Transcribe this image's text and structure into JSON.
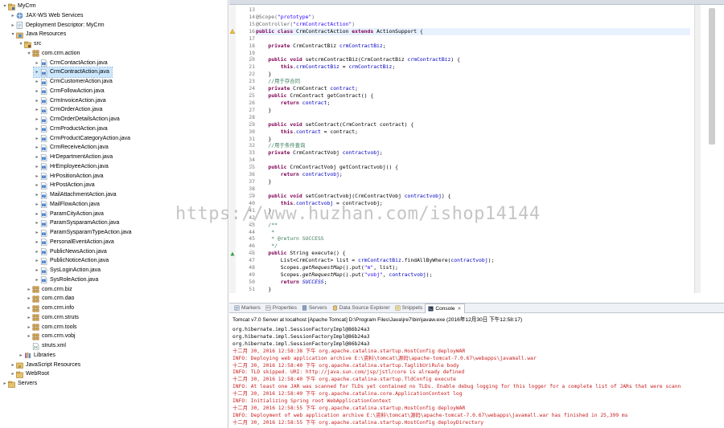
{
  "explorer": {
    "items": [
      {
        "label": "MyCrm",
        "depth": 0,
        "tw": "▾",
        "icon": "project"
      },
      {
        "label": "JAX-WS Web Services",
        "depth": 1,
        "tw": "▸",
        "icon": "webservice"
      },
      {
        "label": "Deployment Descriptor: MyCrm",
        "depth": 1,
        "tw": "▸",
        "icon": "descriptor"
      },
      {
        "label": "Java Resources",
        "depth": 1,
        "tw": "▾",
        "icon": "javares"
      },
      {
        "label": "src",
        "depth": 2,
        "tw": "▾",
        "icon": "srcfolder"
      },
      {
        "label": "com.crm.action",
        "depth": 3,
        "tw": "▾",
        "icon": "package"
      },
      {
        "label": "CrmContactAction.java",
        "depth": 4,
        "tw": "▸",
        "icon": "java"
      },
      {
        "label": "CrmContractAction.java",
        "depth": 4,
        "tw": "▸",
        "icon": "java",
        "selected": true
      },
      {
        "label": "CrmCustomerAction.java",
        "depth": 4,
        "tw": "▸",
        "icon": "java"
      },
      {
        "label": "CrmFollowAction.java",
        "depth": 4,
        "tw": "▸",
        "icon": "java"
      },
      {
        "label": "CrmInvoiceAction.java",
        "depth": 4,
        "tw": "▸",
        "icon": "java"
      },
      {
        "label": "CrmOrderAction.java",
        "depth": 4,
        "tw": "▸",
        "icon": "java"
      },
      {
        "label": "CrmOrderDetailsAction.java",
        "depth": 4,
        "tw": "▸",
        "icon": "java"
      },
      {
        "label": "CrmProductAction.java",
        "depth": 4,
        "tw": "▸",
        "icon": "java"
      },
      {
        "label": "CrmProductCategoryAction.java",
        "depth": 4,
        "tw": "▸",
        "icon": "java"
      },
      {
        "label": "CrmReceiveAction.java",
        "depth": 4,
        "tw": "▸",
        "icon": "java"
      },
      {
        "label": "HrDepartmentAction.java",
        "depth": 4,
        "tw": "▸",
        "icon": "java"
      },
      {
        "label": "HrEmployeeAction.java",
        "depth": 4,
        "tw": "▸",
        "icon": "java"
      },
      {
        "label": "HrPositionAction.java",
        "depth": 4,
        "tw": "▸",
        "icon": "java"
      },
      {
        "label": "HrPostAction.java",
        "depth": 4,
        "tw": "▸",
        "icon": "java"
      },
      {
        "label": "MailAttachmentAction.java",
        "depth": 4,
        "tw": "▸",
        "icon": "java"
      },
      {
        "label": "MailFlowAction.java",
        "depth": 4,
        "tw": "▸",
        "icon": "java"
      },
      {
        "label": "ParamCityAction.java",
        "depth": 4,
        "tw": "▸",
        "icon": "java"
      },
      {
        "label": "ParamSysparamAction.java",
        "depth": 4,
        "tw": "▸",
        "icon": "java"
      },
      {
        "label": "ParamSysparamTypeAction.java",
        "depth": 4,
        "tw": "▸",
        "icon": "java"
      },
      {
        "label": "PersonalEventAction.java",
        "depth": 4,
        "tw": "▸",
        "icon": "java"
      },
      {
        "label": "PublicNewsAction.java",
        "depth": 4,
        "tw": "▸",
        "icon": "java"
      },
      {
        "label": "PublicNoticeAction.java",
        "depth": 4,
        "tw": "▸",
        "icon": "java"
      },
      {
        "label": "SysLoginAction.java",
        "depth": 4,
        "tw": "▸",
        "icon": "java"
      },
      {
        "label": "SysRoleAction.java",
        "depth": 4,
        "tw": "▸",
        "icon": "java"
      },
      {
        "label": "com.crm.biz",
        "depth": 3,
        "tw": "▸",
        "icon": "package"
      },
      {
        "label": "com.crm.dao",
        "depth": 3,
        "tw": "▸",
        "icon": "package"
      },
      {
        "label": "com.crm.info",
        "depth": 3,
        "tw": "▸",
        "icon": "package"
      },
      {
        "label": "com.crm.struts",
        "depth": 3,
        "tw": "▸",
        "icon": "package"
      },
      {
        "label": "com.crm.tools",
        "depth": 3,
        "tw": "▸",
        "icon": "package"
      },
      {
        "label": "com.crm.vobj",
        "depth": 3,
        "tw": "▸",
        "icon": "package"
      },
      {
        "label": "struts.xml",
        "depth": 3,
        "tw": "",
        "icon": "xml"
      },
      {
        "label": "Libraries",
        "depth": 2,
        "tw": "▸",
        "icon": "library"
      },
      {
        "label": "JavaScript Resources",
        "depth": 1,
        "tw": "▸",
        "icon": "jsres"
      },
      {
        "label": "WebRoot",
        "depth": 1,
        "tw": "▸",
        "icon": "folder"
      },
      {
        "label": "Servers",
        "depth": 0,
        "tw": "▸",
        "icon": "folder"
      }
    ]
  },
  "editor": {
    "lines": [
      {
        "n": "13",
        "segs": []
      },
      {
        "n": "14",
        "segs": [
          {
            "t": "@Scope(",
            "c": "an"
          },
          {
            "t": "\"prototype\"",
            "c": "st"
          },
          {
            "t": ")",
            "c": "an"
          }
        ]
      },
      {
        "n": "15",
        "segs": [
          {
            "t": "@Controller(",
            "c": "an"
          },
          {
            "t": "\"crmContractAction\"",
            "c": "st"
          },
          {
            "t": ")",
            "c": "an"
          }
        ]
      },
      {
        "n": "16",
        "marker": "warn",
        "segs": [
          {
            "t": "public class ",
            "c": "kw"
          },
          {
            "t": "CrmContractAction ",
            "c": ""
          },
          {
            "t": "extends ",
            "c": "kw"
          },
          {
            "t": "ActionSupport {",
            "c": ""
          }
        ]
      },
      {
        "n": "17",
        "segs": []
      },
      {
        "n": "18",
        "segs": [
          {
            "t": "    private ",
            "c": "kw"
          },
          {
            "t": "CrmContractBiz ",
            "c": ""
          },
          {
            "t": "crmContractBiz",
            "c": "fd"
          },
          {
            "t": ";",
            "c": ""
          }
        ]
      },
      {
        "n": "19",
        "segs": []
      },
      {
        "n": "20",
        "fold": true,
        "segs": [
          {
            "t": "    public void ",
            "c": "kw"
          },
          {
            "t": "setcrmContractBiz(CrmContractBiz ",
            "c": ""
          },
          {
            "t": "crmContractBiz",
            "c": "fd"
          },
          {
            "t": ") {",
            "c": ""
          }
        ]
      },
      {
        "n": "21",
        "segs": [
          {
            "t": "        this",
            "c": "kw"
          },
          {
            "t": ".",
            "c": ""
          },
          {
            "t": "crmContractBiz",
            "c": "fd"
          },
          {
            "t": " = ",
            "c": ""
          },
          {
            "t": "crmContractBiz",
            "c": "fd"
          },
          {
            "t": ";",
            "c": ""
          }
        ]
      },
      {
        "n": "22",
        "segs": [
          {
            "t": "    }",
            "c": ""
          }
        ]
      },
      {
        "n": "23",
        "segs": [
          {
            "t": "    //用于存合同",
            "c": "cm"
          }
        ]
      },
      {
        "n": "24",
        "segs": [
          {
            "t": "    private ",
            "c": "kw"
          },
          {
            "t": "CrmContract ",
            "c": ""
          },
          {
            "t": "contract",
            "c": "fd"
          },
          {
            "t": ";",
            "c": ""
          }
        ]
      },
      {
        "n": "25",
        "fold": true,
        "segs": [
          {
            "t": "    public ",
            "c": "kw"
          },
          {
            "t": "CrmContract getContract() {",
            "c": ""
          }
        ]
      },
      {
        "n": "26",
        "segs": [
          {
            "t": "        return ",
            "c": "kw"
          },
          {
            "t": "contract",
            "c": "fd"
          },
          {
            "t": ";",
            "c": ""
          }
        ]
      },
      {
        "n": "27",
        "segs": [
          {
            "t": "    }",
            "c": ""
          }
        ]
      },
      {
        "n": "28",
        "segs": []
      },
      {
        "n": "29",
        "fold": true,
        "segs": [
          {
            "t": "    public void ",
            "c": "kw"
          },
          {
            "t": "setContract(CrmContract contract) {",
            "c": ""
          }
        ]
      },
      {
        "n": "30",
        "segs": [
          {
            "t": "        this",
            "c": "kw"
          },
          {
            "t": ".",
            "c": ""
          },
          {
            "t": "contract",
            "c": "fd"
          },
          {
            "t": " = contract;",
            "c": ""
          }
        ]
      },
      {
        "n": "31",
        "segs": [
          {
            "t": "    }",
            "c": ""
          }
        ]
      },
      {
        "n": "32",
        "segs": [
          {
            "t": "    //用于条件查询",
            "c": "cm"
          }
        ]
      },
      {
        "n": "33",
        "segs": [
          {
            "t": "    private ",
            "c": "kw"
          },
          {
            "t": "CrmContractVobj ",
            "c": ""
          },
          {
            "t": "contractvobj",
            "c": "fd"
          },
          {
            "t": ";",
            "c": ""
          }
        ]
      },
      {
        "n": "34",
        "segs": []
      },
      {
        "n": "35",
        "fold": true,
        "segs": [
          {
            "t": "    public ",
            "c": "kw"
          },
          {
            "t": "CrmContractVobj getContractvobj() {",
            "c": ""
          }
        ]
      },
      {
        "n": "36",
        "segs": [
          {
            "t": "        return ",
            "c": "kw"
          },
          {
            "t": "contractvobj",
            "c": "fd"
          },
          {
            "t": ";",
            "c": ""
          }
        ]
      },
      {
        "n": "37",
        "segs": [
          {
            "t": "    }",
            "c": ""
          }
        ]
      },
      {
        "n": "38",
        "segs": []
      },
      {
        "n": "39",
        "fold": true,
        "segs": [
          {
            "t": "    public void ",
            "c": "kw"
          },
          {
            "t": "setContractvobj(CrmContractVobj ",
            "c": ""
          },
          {
            "t": "contractvobj",
            "c": "fd"
          },
          {
            "t": ") {",
            "c": ""
          }
        ]
      },
      {
        "n": "40",
        "segs": [
          {
            "t": "        this",
            "c": "kw"
          },
          {
            "t": ".",
            "c": ""
          },
          {
            "t": "contractvobj",
            "c": "fd"
          },
          {
            "t": " = contractvobj;",
            "c": ""
          }
        ]
      },
      {
        "n": "41",
        "segs": [
          {
            "t": "    }",
            "c": ""
          }
        ]
      },
      {
        "n": "42",
        "segs": []
      },
      {
        "n": "43",
        "fold": true,
        "segs": [
          {
            "t": "    /**",
            "c": "cm"
          }
        ]
      },
      {
        "n": "44",
        "segs": [
          {
            "t": "     * ",
            "c": "cm"
          }
        ]
      },
      {
        "n": "45",
        "segs": [
          {
            "t": "     * @return SUCCESS",
            "c": "cm"
          }
        ]
      },
      {
        "n": "46",
        "segs": [
          {
            "t": "     */",
            "c": "cm"
          }
        ]
      },
      {
        "n": "46",
        "marker": "override",
        "fold": true,
        "segs": [
          {
            "t": "    public ",
            "c": "kw"
          },
          {
            "t": "String execute() {",
            "c": ""
          }
        ]
      },
      {
        "n": "47",
        "segs": [
          {
            "t": "        List<CrmContract> list = ",
            "c": ""
          },
          {
            "t": "crmContractBiz",
            "c": "fd"
          },
          {
            "t": ".findAllByWhere(",
            "c": ""
          },
          {
            "t": "contractvobj",
            "c": "fd"
          },
          {
            "t": ");",
            "c": ""
          }
        ]
      },
      {
        "n": "48",
        "segs": [
          {
            "t": "        Scopes.",
            "c": ""
          },
          {
            "t": "getRequestMap",
            "c": "ic2"
          },
          {
            "t": "().put(",
            "c": ""
          },
          {
            "t": "\"m\"",
            "c": "st"
          },
          {
            "t": ", list);",
            "c": ""
          }
        ]
      },
      {
        "n": "49",
        "segs": [
          {
            "t": "        Scopes.",
            "c": ""
          },
          {
            "t": "getRequestMap",
            "c": "ic2"
          },
          {
            "t": "().put(",
            "c": ""
          },
          {
            "t": "\"vobj\"",
            "c": "st"
          },
          {
            "t": ", ",
            "c": ""
          },
          {
            "t": "contractvobj",
            "c": "fd"
          },
          {
            "t": ");",
            "c": ""
          }
        ]
      },
      {
        "n": "50",
        "segs": [
          {
            "t": "        return ",
            "c": "kw"
          },
          {
            "t": "SUCCESS",
            "c": "fd ic2"
          },
          {
            "t": ";",
            "c": ""
          }
        ]
      },
      {
        "n": "51",
        "segs": [
          {
            "t": "    }",
            "c": ""
          }
        ]
      },
      {
        "n": "52",
        "segs": []
      }
    ]
  },
  "views": {
    "tabs": [
      {
        "label": "Markers",
        "icon": "markers"
      },
      {
        "label": "Properties",
        "icon": "properties"
      },
      {
        "label": "Servers",
        "icon": "servers"
      },
      {
        "label": "Data Source Explorer",
        "icon": "datasource"
      },
      {
        "label": "Snippets",
        "icon": "snippets"
      },
      {
        "label": "Console",
        "icon": "console",
        "active": true
      }
    ],
    "close": "✕"
  },
  "console": {
    "title": "Tomcat v7.0 Server at localhost [Apache Tomcat] D:\\Program Files\\Java\\jre7\\bin\\javaw.exe (2016年12月30日 下午12:58:17)",
    "lines": [
      {
        "t": "org.hibernate.impl.SessionFactoryImpl@86b24a3",
        "c": "b"
      },
      {
        "t": "org.hibernate.impl.SessionFactoryImpl@86b24a3",
        "c": "b"
      },
      {
        "t": "org.hibernate.impl.SessionFactoryImpl@86b24a3",
        "c": "b"
      },
      {
        "t": "十二月 30, 2016 12:58:38 下午 org.apache.catalina.startup.HostConfig deployWAR",
        "c": "r"
      },
      {
        "t": "INFO: Deploying web application archive E:\\资料\\tomcat\\源码\\apache-tomcat-7.0.67\\webapps\\javamall.war",
        "c": "r"
      },
      {
        "t": "十二月 30, 2016 12:58:40 下午 org.apache.catalina.startup.TaglibUriRule body",
        "c": "r"
      },
      {
        "t": "INFO: TLD skipped. URI: http://java.sun.com/jsp/jstl/core is already defined",
        "c": "r"
      },
      {
        "t": "十二月 30, 2016 12:58:40 下午 org.apache.catalina.startup.TldConfig execute",
        "c": "r"
      },
      {
        "t": "INFO: At least one JAR was scanned for TLDs yet contained no TLDs. Enable debug logging for this logger for a complete list of JARs that were scann",
        "c": "r"
      },
      {
        "t": "十二月 30, 2016 12:58:40 下午 org.apache.catalina.core.ApplicationContext log",
        "c": "r"
      },
      {
        "t": "INFO: Initializing Spring root WebApplicationContext",
        "c": "r"
      },
      {
        "t": "十二月 30, 2016 12:58:55 下午 org.apache.catalina.startup.HostConfig deployWAR",
        "c": "r"
      },
      {
        "t": "INFO: Deployment of web application archive E:\\资料\\tomcat\\源码\\apache-tomcat-7.0.67\\webapps\\javamall.war has finished in 25,399 ms",
        "c": "r"
      },
      {
        "t": "十二月 30, 2016 12:58:55 下午 org.apache.catalina.startup.HostConfig deployDirectory",
        "c": "r"
      }
    ]
  },
  "watermark": "https://www.huzhan.com/ishop14144",
  "colors": {
    "keyword": "#7f0055",
    "annotation": "#646464",
    "string": "#2a00ff",
    "field": "#0000c0",
    "comment": "#3f7f5f",
    "error": "#c81e1e",
    "selection": "#cce8ff"
  }
}
